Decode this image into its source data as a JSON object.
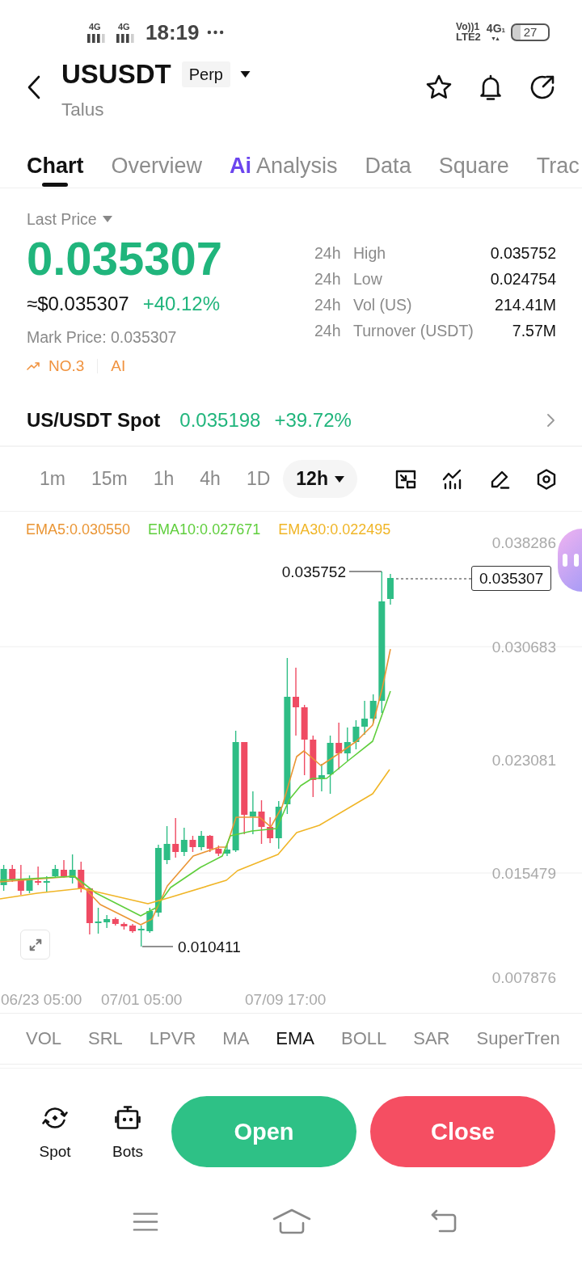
{
  "status_bar": {
    "sims": [
      {
        "network": "4G"
      },
      {
        "network": "4G"
      }
    ],
    "time": "18:19",
    "volte_top": "Vo))1",
    "volte_bottom": "LTE2",
    "data_network": "4G$_{1}$",
    "battery": "27"
  },
  "header": {
    "symbol": "USUSDT",
    "badge": "Perp",
    "name": "Talus"
  },
  "tabs": [
    {
      "label": "Chart",
      "selected": true
    },
    {
      "label": "Overview",
      "selected": false
    },
    {
      "label": "Analysis",
      "prefix": "Ai",
      "selected": false
    },
    {
      "label": "Data",
      "selected": false
    },
    {
      "label": "Square",
      "selected": false
    },
    {
      "label": "Trac",
      "selected": false
    }
  ],
  "price": {
    "label": "Last Price",
    "value": "0.035307",
    "usd": "≈$0.035307",
    "change": "+40.12%",
    "mark": "Mark Price: 0.035307",
    "rank": "NO.3",
    "tag": "AI"
  },
  "stats": [
    {
      "period": "24h",
      "label": "High",
      "value": "0.035752"
    },
    {
      "period": "24h",
      "label": "Low",
      "value": "0.024754"
    },
    {
      "period": "24h",
      "label": "Vol (US)",
      "value": "214.41M"
    },
    {
      "period": "24h",
      "label": "Turnover (USDT)",
      "value": "7.57M"
    }
  ],
  "spot": {
    "pair": "US/USDT Spot",
    "price": "0.035198",
    "change": "+39.72%"
  },
  "intervals": [
    {
      "label": "1m",
      "selected": false
    },
    {
      "label": "15m",
      "selected": false
    },
    {
      "label": "1h",
      "selected": false
    },
    {
      "label": "4h",
      "selected": false
    },
    {
      "label": "1D",
      "selected": false
    },
    {
      "label": "12h",
      "selected": true
    }
  ],
  "chart": {
    "ema": [
      {
        "label": "EMA5:0.030550",
        "color": "#ea9534"
      },
      {
        "label": "EMA10:0.027671",
        "color": "#5fce3c"
      },
      {
        "label": "EMA30:0.022495",
        "color": "#f0b526"
      }
    ],
    "price_axis": [
      "0.038286",
      "0.030683",
      "0.023081",
      "0.015479",
      "0.007876"
    ],
    "time_axis": [
      "06/23 05:00",
      "07/01 05:00",
      "07/09 17:00"
    ],
    "high_label": "0.035752",
    "low_label": "0.010411",
    "last_price": "0.035307"
  },
  "indicators": [
    {
      "label": "VOL",
      "selected": false
    },
    {
      "label": "SRL",
      "selected": false
    },
    {
      "label": "LPVR",
      "selected": false
    },
    {
      "label": "MA",
      "selected": false
    },
    {
      "label": "EMA",
      "selected": true
    },
    {
      "label": "BOLL",
      "selected": false
    },
    {
      "label": "SAR",
      "selected": false
    },
    {
      "label": "SuperTren",
      "selected": false
    }
  ],
  "actions": {
    "shortcuts": [
      {
        "label": "Spot",
        "kind": "spot"
      },
      {
        "label": "Bots",
        "kind": "bots"
      }
    ],
    "buttons": [
      {
        "label": "Open",
        "kind": "open"
      },
      {
        "label": "Close",
        "kind": "close"
      }
    ]
  }
}
